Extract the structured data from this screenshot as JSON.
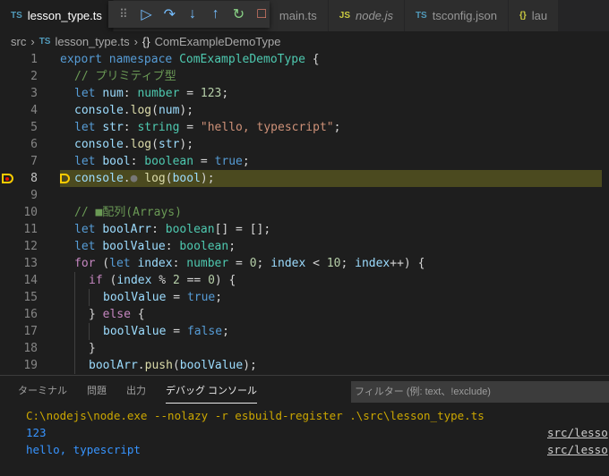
{
  "tabs": [
    {
      "icon": "TS",
      "label": "lesson_type.ts",
      "active": true,
      "iconColor": "#519aba"
    },
    {
      "icon": "",
      "label": "main.ts",
      "active": false,
      "iconColor": "#519aba"
    },
    {
      "icon": "JS",
      "label": "node.js",
      "active": false,
      "iconColor": "#cbcb41"
    },
    {
      "icon": "TS",
      "label": "tsconfig.json",
      "active": false,
      "iconColor": "#519aba"
    },
    {
      "icon": "{}",
      "label": "lau",
      "active": false,
      "iconColor": "#cbcb41"
    }
  ],
  "debug_toolbar": {
    "grip": "⠿",
    "continue": "▷",
    "step_over": "↷",
    "step_into": "↓",
    "step_out": "↑",
    "restart": "↻",
    "stop": "□"
  },
  "breadcrumb": {
    "folder": "src",
    "file_icon": "TS",
    "file": "lesson_type.ts",
    "symbol_icon": "{}",
    "symbol": "ComExampleDemoType",
    "sep": "›"
  },
  "current_line": 8,
  "code": [
    {
      "n": "1",
      "indent": 0,
      "t": [
        [
          "kw",
          "export"
        ],
        [
          "pl",
          " "
        ],
        [
          "kw",
          "namespace"
        ],
        [
          "pl",
          " "
        ],
        [
          "typ",
          "ComExampleDemoType"
        ],
        [
          "pl",
          " {"
        ]
      ]
    },
    {
      "n": "2",
      "indent": 1,
      "t": [
        [
          "cm",
          "// プリミティブ型"
        ]
      ]
    },
    {
      "n": "3",
      "indent": 1,
      "t": [
        [
          "kw",
          "let"
        ],
        [
          "pl",
          " "
        ],
        [
          "var",
          "num"
        ],
        [
          "pl",
          ": "
        ],
        [
          "typ",
          "number"
        ],
        [
          "pl",
          " = "
        ],
        [
          "num",
          "123"
        ],
        [
          "pl",
          ";"
        ]
      ]
    },
    {
      "n": "4",
      "indent": 1,
      "t": [
        [
          "var",
          "console"
        ],
        [
          "pl",
          "."
        ],
        [
          "fn",
          "log"
        ],
        [
          "pl",
          "("
        ],
        [
          "var",
          "num"
        ],
        [
          "pl",
          ");"
        ]
      ]
    },
    {
      "n": "5",
      "indent": 1,
      "t": [
        [
          "kw",
          "let"
        ],
        [
          "pl",
          " "
        ],
        [
          "var",
          "str"
        ],
        [
          "pl",
          ": "
        ],
        [
          "typ",
          "string"
        ],
        [
          "pl",
          " = "
        ],
        [
          "str",
          "\"hello, typescript\""
        ],
        [
          "pl",
          ";"
        ]
      ]
    },
    {
      "n": "6",
      "indent": 1,
      "t": [
        [
          "var",
          "console"
        ],
        [
          "pl",
          "."
        ],
        [
          "fn",
          "log"
        ],
        [
          "pl",
          "("
        ],
        [
          "var",
          "str"
        ],
        [
          "pl",
          ");"
        ]
      ]
    },
    {
      "n": "7",
      "indent": 1,
      "t": [
        [
          "kw",
          "let"
        ],
        [
          "pl",
          " "
        ],
        [
          "var",
          "bool"
        ],
        [
          "pl",
          ": "
        ],
        [
          "typ",
          "boolean"
        ],
        [
          "pl",
          " = "
        ],
        [
          "kw",
          "true"
        ],
        [
          "pl",
          ";"
        ]
      ]
    },
    {
      "n": "8",
      "indent": 1,
      "t": [
        [
          "var",
          "console"
        ],
        [
          "pl",
          "."
        ],
        [
          "pl",
          "● "
        ],
        [
          "fn",
          "log"
        ],
        [
          "pl",
          "("
        ],
        [
          "var",
          "bool"
        ],
        [
          "pl",
          ");"
        ]
      ]
    },
    {
      "n": "9",
      "indent": 0,
      "t": []
    },
    {
      "n": "10",
      "indent": 1,
      "t": [
        [
          "cm",
          "// ■配列(Arrays)"
        ]
      ]
    },
    {
      "n": "11",
      "indent": 1,
      "t": [
        [
          "kw",
          "let"
        ],
        [
          "pl",
          " "
        ],
        [
          "var",
          "boolArr"
        ],
        [
          "pl",
          ": "
        ],
        [
          "typ",
          "boolean"
        ],
        [
          "pl",
          "[] = [];"
        ]
      ]
    },
    {
      "n": "12",
      "indent": 1,
      "t": [
        [
          "kw",
          "let"
        ],
        [
          "pl",
          " "
        ],
        [
          "var",
          "boolValue"
        ],
        [
          "pl",
          ": "
        ],
        [
          "typ",
          "boolean"
        ],
        [
          "pl",
          ";"
        ]
      ]
    },
    {
      "n": "13",
      "indent": 1,
      "t": [
        [
          "ctl",
          "for"
        ],
        [
          "pl",
          " ("
        ],
        [
          "kw",
          "let"
        ],
        [
          "pl",
          " "
        ],
        [
          "var",
          "index"
        ],
        [
          "pl",
          ": "
        ],
        [
          "typ",
          "number"
        ],
        [
          "pl",
          " = "
        ],
        [
          "num",
          "0"
        ],
        [
          "pl",
          "; "
        ],
        [
          "var",
          "index"
        ],
        [
          "pl",
          " < "
        ],
        [
          "num",
          "10"
        ],
        [
          "pl",
          "; "
        ],
        [
          "var",
          "index"
        ],
        [
          "pl",
          "++) {"
        ]
      ]
    },
    {
      "n": "14",
      "indent": 2,
      "t": [
        [
          "ctl",
          "if"
        ],
        [
          "pl",
          " ("
        ],
        [
          "var",
          "index"
        ],
        [
          "pl",
          " % "
        ],
        [
          "num",
          "2"
        ],
        [
          "pl",
          " == "
        ],
        [
          "num",
          "0"
        ],
        [
          "pl",
          ") {"
        ]
      ]
    },
    {
      "n": "15",
      "indent": 3,
      "t": [
        [
          "var",
          "boolValue"
        ],
        [
          "pl",
          " = "
        ],
        [
          "kw",
          "true"
        ],
        [
          "pl",
          ";"
        ]
      ]
    },
    {
      "n": "16",
      "indent": 2,
      "t": [
        [
          "pl",
          "} "
        ],
        [
          "ctl",
          "else"
        ],
        [
          "pl",
          " {"
        ]
      ]
    },
    {
      "n": "17",
      "indent": 3,
      "t": [
        [
          "var",
          "boolValue"
        ],
        [
          "pl",
          " = "
        ],
        [
          "kw",
          "false"
        ],
        [
          "pl",
          ";"
        ]
      ]
    },
    {
      "n": "18",
      "indent": 2,
      "t": [
        [
          "pl",
          "}"
        ]
      ]
    },
    {
      "n": "19",
      "indent": 2,
      "t": [
        [
          "var",
          "boolArr"
        ],
        [
          "pl",
          "."
        ],
        [
          "fn",
          "push"
        ],
        [
          "pl",
          "("
        ],
        [
          "var",
          "boolValue"
        ],
        [
          "pl",
          ");"
        ]
      ]
    }
  ],
  "panel": {
    "tabs": [
      "ターミナル",
      "問題",
      "出力",
      "デバッグ コンソール"
    ],
    "active_tab": 3,
    "filter_placeholder": "フィルター (例: text、!exclude)",
    "output": [
      {
        "text": "C:\\nodejs\\node.exe --nolazy -r esbuild-register .\\src\\lesson_type.ts",
        "color": "#cca700",
        "source": ""
      },
      {
        "text": "123",
        "color": "#3794ff",
        "source": "src/lesso"
      },
      {
        "text": "hello, typescript",
        "color": "#3794ff",
        "source": "src/lesso"
      }
    ]
  }
}
